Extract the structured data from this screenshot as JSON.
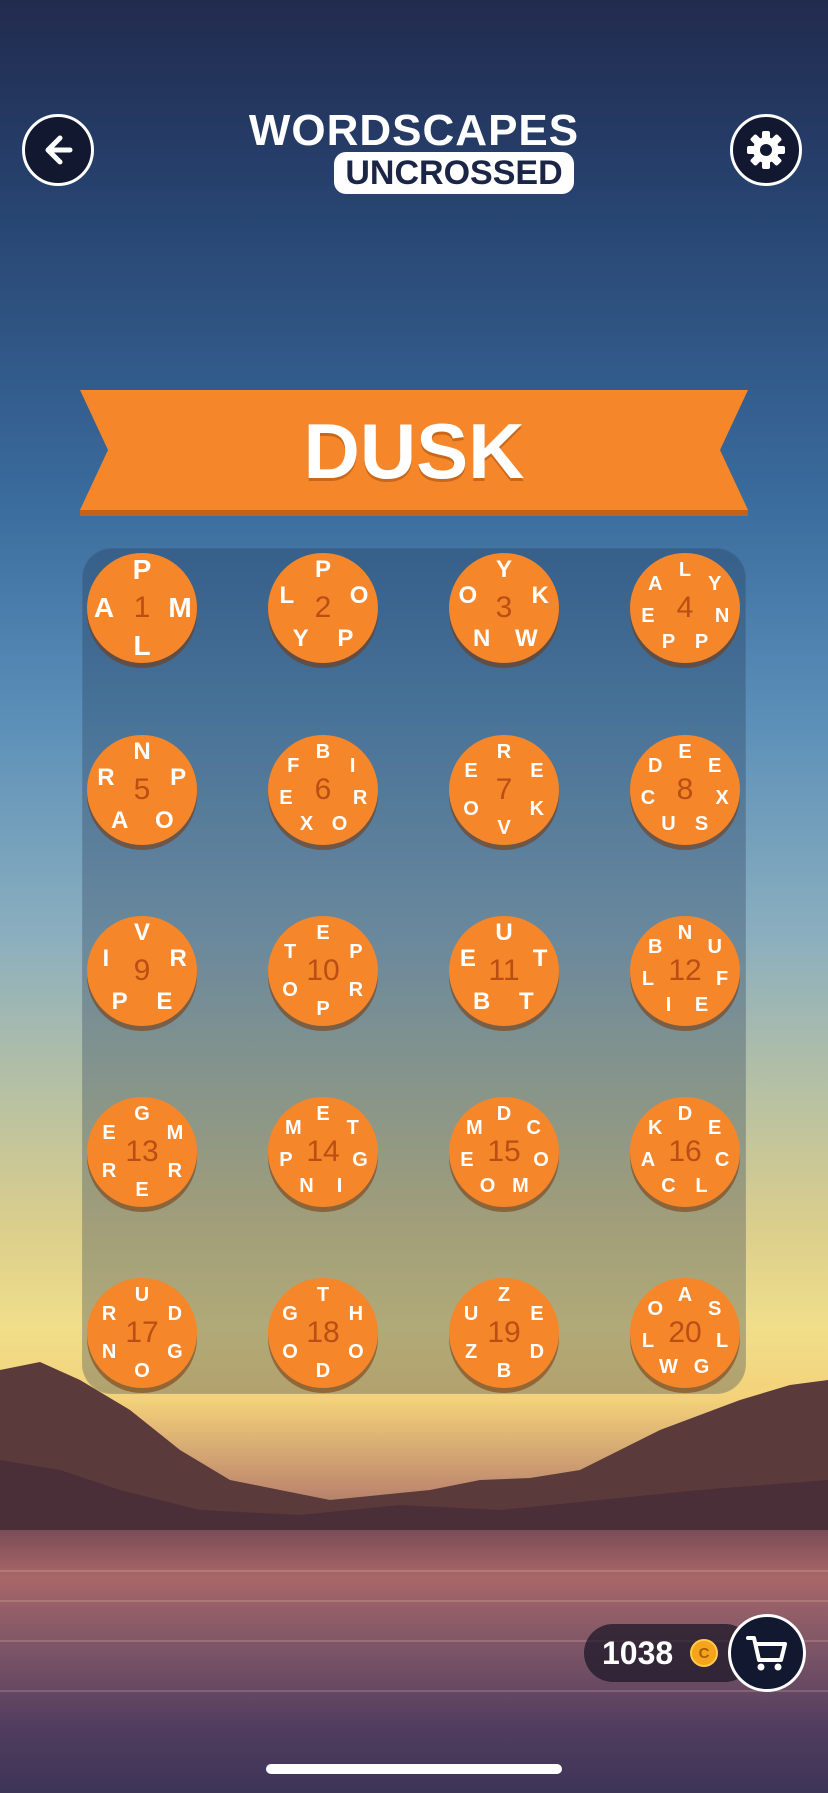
{
  "header": {
    "back_icon": "arrow-left-icon",
    "settings_icon": "gear-icon",
    "logo_top": "WORDSCAPES",
    "logo_bottom": "UNCROSSED"
  },
  "pack": {
    "title": "DUSK",
    "ribbon_color": "#f5862a"
  },
  "levels": [
    {
      "number": "1",
      "letters": [
        "P",
        "M",
        "L",
        "A"
      ]
    },
    {
      "number": "2",
      "letters": [
        "P",
        "O",
        "P",
        "Y",
        "L"
      ]
    },
    {
      "number": "3",
      "letters": [
        "Y",
        "K",
        "W",
        "N",
        "O"
      ]
    },
    {
      "number": "4",
      "letters": [
        "L",
        "Y",
        "N",
        "P",
        "P",
        "E",
        "A"
      ]
    },
    {
      "number": "5",
      "letters": [
        "N",
        "P",
        "O",
        "A",
        "R"
      ]
    },
    {
      "number": "6",
      "letters": [
        "B",
        "I",
        "R",
        "O",
        "X",
        "E",
        "F"
      ]
    },
    {
      "number": "7",
      "letters": [
        "R",
        "E",
        "K",
        "V",
        "O",
        "E"
      ]
    },
    {
      "number": "8",
      "letters": [
        "E",
        "E",
        "X",
        "S",
        "U",
        "C",
        "D"
      ]
    },
    {
      "number": "9",
      "letters": [
        "V",
        "R",
        "E",
        "P",
        "I"
      ]
    },
    {
      "number": "10",
      "letters": [
        "E",
        "P",
        "R",
        "P",
        "O",
        "T"
      ]
    },
    {
      "number": "11",
      "letters": [
        "U",
        "T",
        "T",
        "B",
        "E"
      ]
    },
    {
      "number": "12",
      "letters": [
        "N",
        "U",
        "F",
        "E",
        "I",
        "L",
        "B"
      ]
    },
    {
      "number": "13",
      "letters": [
        "G",
        "M",
        "R",
        "E",
        "R",
        "E"
      ]
    },
    {
      "number": "14",
      "letters": [
        "E",
        "T",
        "G",
        "I",
        "N",
        "P",
        "M"
      ]
    },
    {
      "number": "15",
      "letters": [
        "D",
        "C",
        "O",
        "M",
        "O",
        "E",
        "M"
      ]
    },
    {
      "number": "16",
      "letters": [
        "D",
        "E",
        "C",
        "L",
        "C",
        "A",
        "K"
      ]
    },
    {
      "number": "17",
      "letters": [
        "U",
        "D",
        "G",
        "O",
        "N",
        "R"
      ]
    },
    {
      "number": "18",
      "letters": [
        "T",
        "H",
        "O",
        "D",
        "O",
        "G"
      ]
    },
    {
      "number": "19",
      "letters": [
        "Z",
        "E",
        "D",
        "B",
        "Z",
        "U"
      ]
    },
    {
      "number": "20",
      "letters": [
        "A",
        "S",
        "L",
        "G",
        "W",
        "L",
        "O"
      ]
    }
  ],
  "footer": {
    "coins": "1038",
    "coin_symbol": "C",
    "cart_icon": "shopping-cart-icon"
  }
}
